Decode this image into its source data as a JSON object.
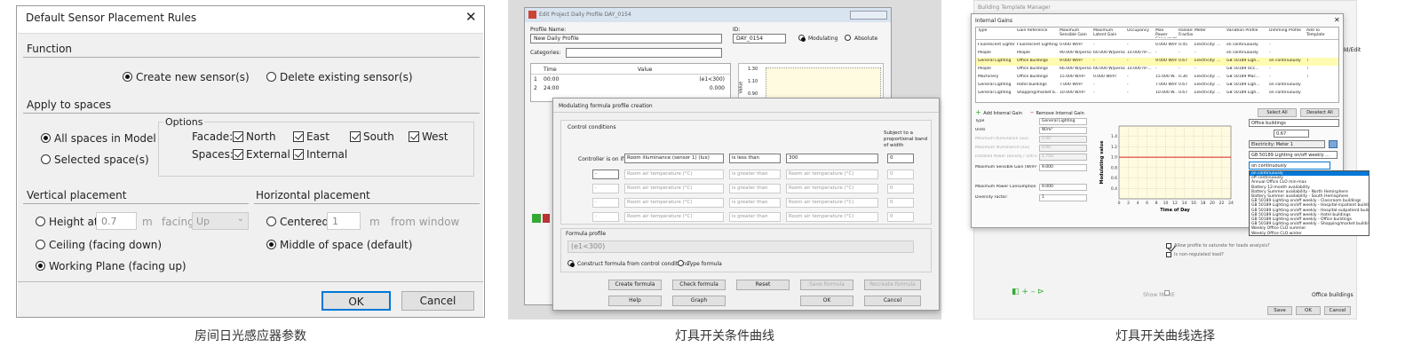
{
  "panel1": {
    "title": "Default Sensor Placement Rules",
    "close_glyph": "✕",
    "function_label": "Function",
    "create_new": "Create new sensor(s)",
    "delete_existing": "Delete existing sensor(s)",
    "apply_label": "Apply to spaces",
    "all_spaces": "All spaces in Model",
    "selected_spaces": "Selected space(s)",
    "options_label": "Options",
    "facade_label": "Facade:",
    "north": "North",
    "east": "East",
    "south": "South",
    "west": "West",
    "spaces_label": "Spaces:",
    "external": "External",
    "internal": "Internal",
    "vertical_label": "Vertical placement",
    "height_at": "Height at",
    "height_value": "0.7",
    "unit_m": "m",
    "facing": "facing",
    "facing_value": "Up",
    "ceiling": "Ceiling (facing down)",
    "working_plane": "Working Plane (facing up)",
    "horizontal_label": "Horizontal placement",
    "centered": "Centered",
    "centered_value": "1",
    "from_window": "from window",
    "middle": "Middle of space (default)",
    "ok": "OK",
    "cancel": "Cancel",
    "caption": "房间日光感应器参数"
  },
  "panel2": {
    "title": "Edit Project Daily Profile DAY_0154",
    "profile_name_label": "Profile Name:",
    "profile_name": "New Daily Profile",
    "id_label": "ID:",
    "id_value": "DAY_0154",
    "modulating": "Modulating",
    "absolute": "Absolute",
    "categories_label": "Categories:",
    "col_time": "Time",
    "col_value": "Value",
    "rows": [
      {
        "n": "1",
        "time": "00:00",
        "value": "(e1<300)"
      },
      {
        "n": "2",
        "time": "24:00",
        "value": "0.000"
      }
    ],
    "graph_ticks": [
      "1.30",
      "1.10",
      "0.90"
    ],
    "graph_axis": "Value",
    "dialog_title": "Modulating formula profile creation",
    "control_conditions": "Control conditions",
    "subject_to": "Subject to a proportional band of width",
    "controller_on_if": "Controller is on if",
    "cond_first": {
      "var": "Room illuminance (sensor 1) (lux)",
      "op": "is less than",
      "val": "300",
      "band": "0"
    },
    "cond_rows": [
      {
        "logic": "-",
        "var": "Room air temperature (°C)",
        "op": "is greater than",
        "val": "Room air temperature (°C)",
        "band": "0"
      },
      {
        "logic": "-",
        "var": "Room air temperature (°C)",
        "op": "is greater than",
        "val": "Room air temperature (°C)",
        "band": "0"
      },
      {
        "logic": "-",
        "var": "Room air temperature (°C)",
        "op": "is greater than",
        "val": "Room air temperature (°C)",
        "band": "0"
      },
      {
        "logic": "-",
        "var": "Room air temperature (°C)",
        "op": "is greater than",
        "val": "Room air temperature (°C)",
        "band": "0"
      }
    ],
    "formula_profile": "Formula profile",
    "formula": "(e1<300)",
    "construct": "Construct formula from control conditions",
    "type_formula": "Type formula",
    "buttons_row1": [
      "Create formula",
      "Check formula",
      "Reset",
      "Save formula",
      "Recreate formula"
    ],
    "buttons_row2": [
      "Help",
      "Graph",
      "OK",
      "Cancel"
    ],
    "caption": "灯具开关条件曲线"
  },
  "panel3": {
    "title": "Building Template Manager",
    "dialog_title": "Internal Gains",
    "headers": [
      "Type",
      "Gain Reference",
      "Maximum Sensible Gain",
      "Maximum Latent Gain",
      "Occupancy",
      "Max Power Consumption",
      "Radiant Fraction",
      "Meter",
      "Variation Profile",
      "Dimming Profile",
      "Add To Template"
    ],
    "rows": [
      [
        "Fluorescent Lighting",
        "Fluorescent Lighting",
        "0.000 W/m²",
        "-",
        "-",
        "0.000 W/m²",
        "0.45",
        "Electricity: ...",
        "on continuously",
        "-",
        ""
      ],
      [
        "People",
        "People",
        "90.000 W/person",
        "60.000 W/person",
        "10.000 m²...",
        "-",
        "-",
        "-",
        "on continuously",
        "-",
        ""
      ],
      [
        "General Lighting",
        "Office buildings",
        "9.000 W/m²",
        "-",
        "-",
        "9.000 W/m²",
        "0.67",
        "Electricity: ...",
        "GB 50189 Ligh...",
        "on continuously",
        "T"
      ],
      [
        "People",
        "Office buildings",
        "66.000 W/person",
        "66.000 W/person",
        "10.000 m²...",
        "-",
        "-",
        "-",
        "GB 50189 Occ...",
        "-",
        "T"
      ],
      [
        "Machinery",
        "Office buildings",
        "15.000 W/m²",
        "0.000 W/m²",
        "-",
        "15.000 W...",
        "0.30",
        "Electricity: ...",
        "GB 50189 Mac...",
        "-",
        "T"
      ],
      [
        "General Lighting",
        "Hotel buildings",
        "7.000 W/m²",
        "-",
        "-",
        "7.000 W/m²",
        "0.67",
        "Electricity: ...",
        "GB 50189 Ligh...",
        "on continuously",
        ""
      ],
      [
        "General Lighting",
        "Shopping/market b...",
        "10.000 W/m²",
        "-",
        "-",
        "10.000 W...",
        "0.67",
        "Electricity: ...",
        "GB 50189 Ligh...",
        "on continuously",
        ""
      ]
    ],
    "add_gain": "Add Internal Gain",
    "remove_gain": "Remove Internal Gain",
    "select_all": "Select All",
    "deselect_all": "Deselect All",
    "props": [
      {
        "label": "Type",
        "value": "General Lighting"
      },
      {
        "label": "Units",
        "value": "W/m²"
      },
      {
        "label": "Minimum Illuminance (lux)",
        "value": "0.00"
      },
      {
        "label": "Maximum Illuminance (lux)",
        "value": "0.00"
      },
      {
        "label": "Installed Power Density / 100 lux",
        "value": "1.750"
      },
      {
        "label": "Maximum Sensible Gain (W/m²)",
        "value": "9.000"
      },
      {
        "label": "Maximum Power Consumption (W/m²)",
        "value": "9.000"
      },
      {
        "label": "Diversity Factor:",
        "value": "1"
      }
    ],
    "ref_label": "Office buildings",
    "frac_value": "0.67",
    "meter_value": "Electricity: Meter 1",
    "profile_select": "GB 50189 Lighting on/off weekly ...",
    "dimming_select": "on continuously",
    "dropdown": [
      "on continuously",
      "off continuously",
      "Annual Office CLO min-max",
      "Battery 12-month availability",
      "Battery Summer availability - North Hemisphere",
      "Battery Summer availability - South Hemisphere",
      "GB 50189 Lighting on/off weekly - Classroom buildings",
      "GB 50189 Lighting on/off weekly - Hospital-inpatient buildings",
      "GB 50189 Lighting on/off weekly - Hospital-outpatient buildings",
      "GB 50189 Lighting on/off weekly - Hotel buildings",
      "GB 50189 Lighting on/off weekly - Office buildings",
      "GB 50189 Lighting on/off weekly - Shopping/market buildings",
      "Weekly Office CLO summer",
      "Weekly Office CLO winter"
    ],
    "ylabel": "Modulating value",
    "xlabel": "Time of Day",
    "allow_profile": "Allow profile to saturate for loads analysis?",
    "non_regulated": "Is non-regulated load?",
    "show_more": "Show MORE",
    "bottom_ref": "Office buildings",
    "save": "Save",
    "ok": "OK",
    "cancel": "Cancel",
    "side_tab": "dd/Edit",
    "caption": "灯具开关曲线选择"
  },
  "chart_data": {
    "type": "line",
    "xlabel": "Time of Day",
    "ylabel": "Modulating value",
    "xlim": [
      0,
      24
    ],
    "ylim": [
      0.2,
      1.6
    ],
    "xticks": [
      0,
      2,
      4,
      6,
      8,
      10,
      12,
      14,
      16,
      18,
      20,
      22,
      24
    ],
    "yticks": [
      0.4,
      0.6,
      0.8,
      1.0,
      1.2,
      1.4
    ],
    "series": [
      {
        "x": [
          0,
          24
        ],
        "y": [
          1.0,
          1.0
        ],
        "color": "#d62020"
      }
    ],
    "grid": true
  }
}
